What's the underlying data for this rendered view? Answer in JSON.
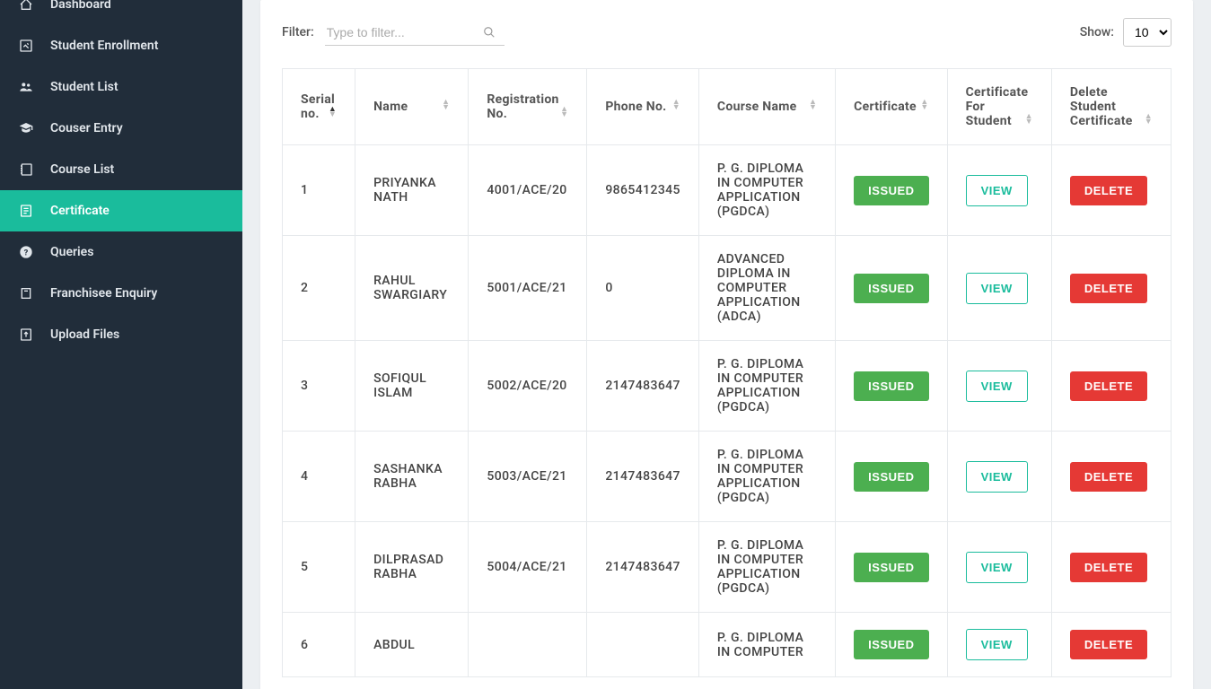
{
  "sidebar": {
    "items": [
      {
        "label": "Dashboard",
        "icon": "home"
      },
      {
        "label": "Student Enrollment",
        "icon": "edit"
      },
      {
        "label": "Student List",
        "icon": "users"
      },
      {
        "label": "Couser Entry",
        "icon": "grad"
      },
      {
        "label": "Course List",
        "icon": "notebook"
      },
      {
        "label": "Certificate",
        "icon": "doc",
        "active": true
      },
      {
        "label": "Queries",
        "icon": "help"
      },
      {
        "label": "Franchisee Enquiry",
        "icon": "flag"
      },
      {
        "label": "Upload Files",
        "icon": "upload"
      }
    ]
  },
  "toolbar": {
    "filter_label": "Filter:",
    "filter_placeholder": "Type to filter...",
    "show_label": "Show:",
    "show_value": "10"
  },
  "columns": [
    "Serial no.",
    "Name",
    "Registration No.",
    "Phone No.",
    "Course Name",
    "Certificate",
    "Certificate For Student",
    "Delete Student Certificate"
  ],
  "buttons": {
    "issued": "ISSUED",
    "view": "VIEW",
    "delete": "DELETE"
  },
  "rows": [
    {
      "serial": "1",
      "name": "PRIYANKA NATH",
      "reg": "4001/ACE/20",
      "phone": "9865412345",
      "course": "P. G. DIPLOMA IN COMPUTER APPLICATION (PGDCA)"
    },
    {
      "serial": "2",
      "name": "RAHUL SWARGIARY",
      "reg": "5001/ACE/21",
      "phone": "0",
      "course": "ADVANCED DIPLOMA IN COMPUTER APPLICATION (ADCA)"
    },
    {
      "serial": "3",
      "name": "SOFIQUL ISLAM",
      "reg": "5002/ACE/20",
      "phone": "2147483647",
      "course": "P. G. DIPLOMA IN COMPUTER APPLICATION (PGDCA)"
    },
    {
      "serial": "4",
      "name": "SASHANKA RABHA",
      "reg": "5003/ACE/21",
      "phone": "2147483647",
      "course": "P. G. DIPLOMA IN COMPUTER APPLICATION (PGDCA)"
    },
    {
      "serial": "5",
      "name": "DILPRASAD RABHA",
      "reg": "5004/ACE/21",
      "phone": "2147483647",
      "course": "P. G. DIPLOMA IN COMPUTER APPLICATION (PGDCA)"
    },
    {
      "serial": "6",
      "name": "ABDUL",
      "reg": "",
      "phone": "",
      "course": "P. G. DIPLOMA IN COMPUTER"
    }
  ]
}
